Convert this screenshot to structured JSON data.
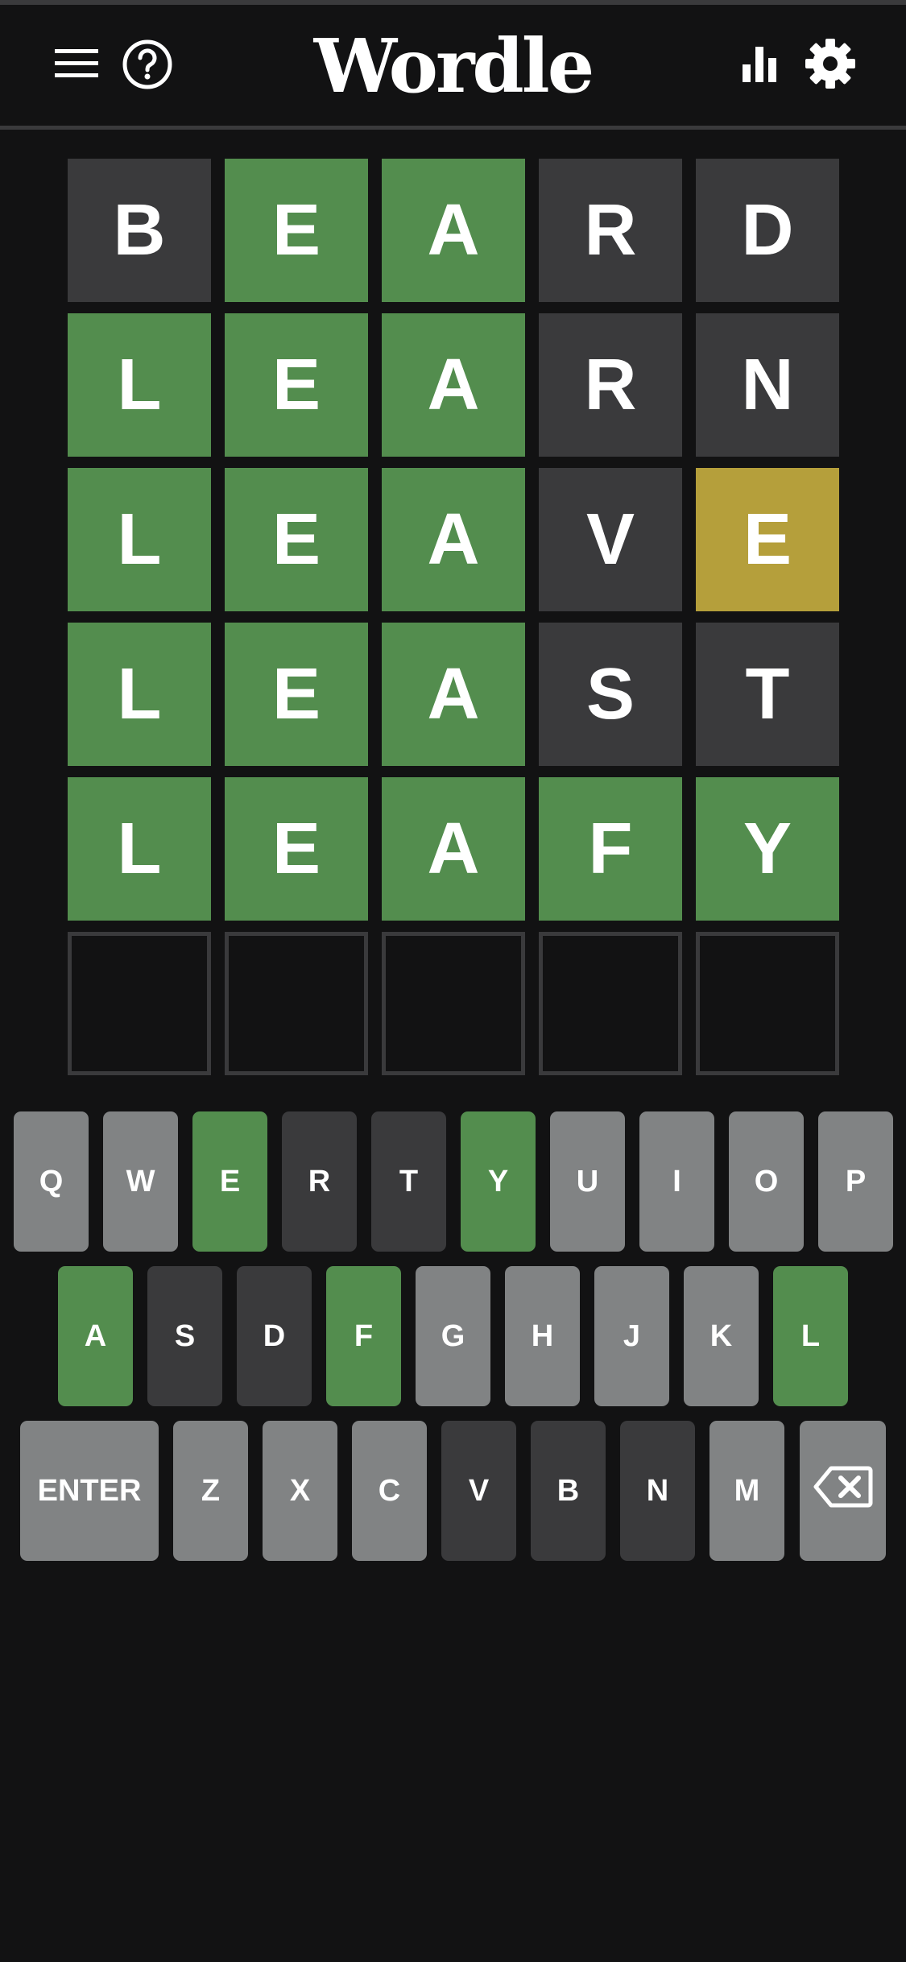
{
  "app": {
    "title": "Wordle"
  },
  "header": {
    "left_icons": [
      "menu-icon",
      "help-icon"
    ],
    "right_icons": [
      "stats-icon",
      "settings-icon"
    ]
  },
  "colors": {
    "background": "#121213",
    "correct": "#538d4e",
    "present": "#b59f3b",
    "absent": "#3a3a3c",
    "unused_key": "#818384",
    "empty_border": "#3a3a3c"
  },
  "board": {
    "rows": [
      {
        "letters": [
          "B",
          "E",
          "A",
          "R",
          "D"
        ],
        "states": [
          "absent",
          "correct",
          "correct",
          "absent",
          "absent"
        ]
      },
      {
        "letters": [
          "L",
          "E",
          "A",
          "R",
          "N"
        ],
        "states": [
          "correct",
          "correct",
          "correct",
          "absent",
          "absent"
        ]
      },
      {
        "letters": [
          "L",
          "E",
          "A",
          "V",
          "E"
        ],
        "states": [
          "correct",
          "correct",
          "correct",
          "absent",
          "present"
        ]
      },
      {
        "letters": [
          "L",
          "E",
          "A",
          "S",
          "T"
        ],
        "states": [
          "correct",
          "correct",
          "correct",
          "absent",
          "absent"
        ]
      },
      {
        "letters": [
          "L",
          "E",
          "A",
          "F",
          "Y"
        ],
        "states": [
          "correct",
          "correct",
          "correct",
          "correct",
          "correct"
        ]
      },
      {
        "letters": [
          "",
          "",
          "",
          "",
          ""
        ],
        "states": [
          "empty",
          "empty",
          "empty",
          "empty",
          "empty"
        ]
      }
    ]
  },
  "keyboard": {
    "rows": [
      [
        {
          "label": "Q",
          "state": "unused"
        },
        {
          "label": "W",
          "state": "unused"
        },
        {
          "label": "E",
          "state": "correct"
        },
        {
          "label": "R",
          "state": "absent"
        },
        {
          "label": "T",
          "state": "absent"
        },
        {
          "label": "Y",
          "state": "correct"
        },
        {
          "label": "U",
          "state": "unused"
        },
        {
          "label": "I",
          "state": "unused"
        },
        {
          "label": "O",
          "state": "unused"
        },
        {
          "label": "P",
          "state": "unused"
        }
      ],
      [
        {
          "label": "A",
          "state": "correct"
        },
        {
          "label": "S",
          "state": "absent"
        },
        {
          "label": "D",
          "state": "absent"
        },
        {
          "label": "F",
          "state": "correct"
        },
        {
          "label": "G",
          "state": "unused"
        },
        {
          "label": "H",
          "state": "unused"
        },
        {
          "label": "J",
          "state": "unused"
        },
        {
          "label": "K",
          "state": "unused"
        },
        {
          "label": "L",
          "state": "correct"
        }
      ],
      [
        {
          "label": "ENTER",
          "state": "unused"
        },
        {
          "label": "Z",
          "state": "unused"
        },
        {
          "label": "X",
          "state": "unused"
        },
        {
          "label": "C",
          "state": "unused"
        },
        {
          "label": "V",
          "state": "absent"
        },
        {
          "label": "B",
          "state": "absent"
        },
        {
          "label": "N",
          "state": "absent"
        },
        {
          "label": "M",
          "state": "unused"
        },
        {
          "label": "",
          "icon": "backspace-icon",
          "state": "unused"
        }
      ]
    ]
  }
}
